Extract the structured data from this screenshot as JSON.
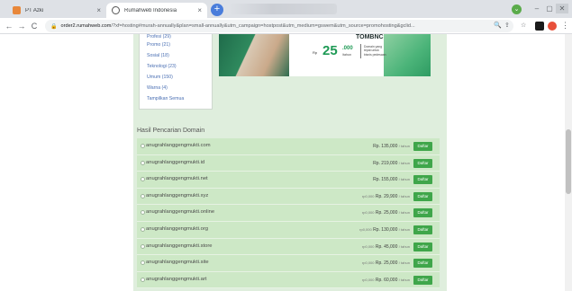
{
  "browser": {
    "tabs": [
      {
        "title": "PT Azki",
        "close": "×"
      },
      {
        "title": "Rumahweb Indonesia",
        "close": "×"
      }
    ],
    "new_tab": "+",
    "nav": {
      "back": "←",
      "forward": "→",
      "reload": "C"
    },
    "url_host": "order2.rumahweb.com",
    "url_rest": "/?xf=hosting#murah-annually&plan=small-annually&utm_campaign=hostpost&utm_medium=gswem&utm_source=promohosting&gclid...",
    "window_controls": {
      "minimize": "–",
      "maximize": "▢",
      "close": "✕"
    }
  },
  "category_dropdown": {
    "items": [
      "Profesi (29)",
      "Promo (21)",
      "Sosial (18)",
      "Teknologi (23)",
      "Umum (150)",
      "Warna (4)",
      "Tampilkan Semua"
    ]
  },
  "banner": {
    "headline": "TOMBNC",
    "currency": "Rp",
    "price_main": "25",
    "price_thousands": ".000",
    "price_sub": "/tahun",
    "note": "Domain yang tepat untuk bisnis pedesaan"
  },
  "search_results": {
    "title": "Hasil Pencarian Domain",
    "button_label": "Daftar",
    "unit": "/ tahun",
    "rows": [
      {
        "domain": "anugrahlanggengmukti.com",
        "old": "",
        "price": "Rp. 135,000"
      },
      {
        "domain": "anugrahlanggengmukti.id",
        "old": "",
        "price": "Rp. 219,000"
      },
      {
        "domain": "anugrahlanggengmukti.net",
        "old": "",
        "price": "Rp. 155,000"
      },
      {
        "domain": "anugrahlanggengmukti.xyz",
        "old": "rp0,000",
        "price": "Rp. 29,900"
      },
      {
        "domain": "anugrahlanggengmukti.online",
        "old": "rp0,000",
        "price": "Rp. 25,000"
      },
      {
        "domain": "anugrahlanggengmukti.org",
        "old": "rp0,000",
        "price": "Rp. 130,000"
      },
      {
        "domain": "anugrahlanggengmukti.store",
        "old": "rp0,000",
        "price": "Rp. 45,000"
      },
      {
        "domain": "anugrahlanggengmukti.site",
        "old": "rp0,000",
        "price": "Rp. 25,000"
      },
      {
        "domain": "anugrahlanggengmukti.art",
        "old": "rp0,000",
        "price": "Rp. 60,000"
      }
    ]
  }
}
